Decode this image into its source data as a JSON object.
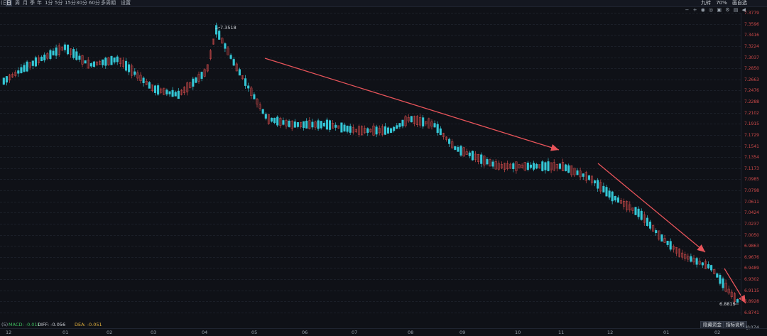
{
  "timeframes": [
    {
      "label": "日",
      "active": true
    },
    {
      "label": "周"
    },
    {
      "label": "月"
    },
    {
      "label": "季"
    },
    {
      "label": "年"
    },
    {
      "label": "1分"
    },
    {
      "label": "5分"
    },
    {
      "label": "15分"
    },
    {
      "label": "30分"
    },
    {
      "label": "60分"
    },
    {
      "label": "多周期"
    },
    {
      "label": "设置"
    }
  ],
  "topbar_prefix": "(日)",
  "right_tools": [
    "九转",
    "70%",
    "画自选"
  ],
  "price_ticks": [
    "7.3779",
    "7.3596",
    "7.3416",
    "7.3224",
    "7.3037",
    "7.2850",
    "7.2663",
    "7.2476",
    "7.2288",
    "7.2102",
    "7.1915",
    "7.1729",
    "7.1541",
    "7.1354",
    "7.1173",
    "7.0985",
    "7.0798",
    "7.0611",
    "7.0424",
    "7.0237",
    "7.0050",
    "6.9863",
    "6.9676",
    "6.9489",
    "6.9302",
    "6.9115",
    "6.8928",
    "6.8741"
  ],
  "annotations": {
    "high": "7.3518",
    "low": "6.8815"
  },
  "macd": {
    "label": "MACD: -0.011",
    "diff": "DIFF: -0.056",
    "dea": "DEA: -0.051",
    "prefix": "(5)"
  },
  "buttons": [
    "隐藏资金",
    "指标说明"
  ],
  "bottom_right": "价074",
  "time_axis": [
    "12",
    "01",
    "02",
    "03",
    "04",
    "05",
    "06",
    "07",
    "08",
    "09",
    "10",
    "11",
    "12",
    "01",
    "02"
  ],
  "colors": {
    "up": "#d14b4b",
    "down": "#35c7d6",
    "arrow": "#e8545a",
    "bg": "#0f1117"
  }
}
